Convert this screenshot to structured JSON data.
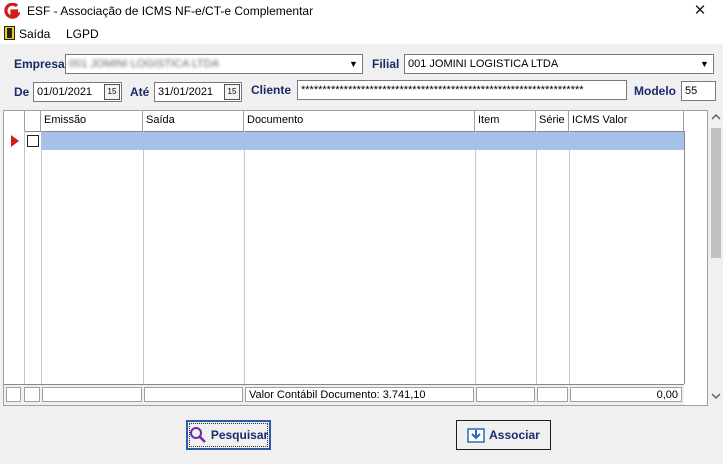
{
  "window": {
    "title": "ESF - Associação de ICMS NF-e/CT-e Complementar",
    "close_glyph": "✕"
  },
  "menu": {
    "items": [
      {
        "label": "Saída"
      },
      {
        "label": "LGPD"
      }
    ]
  },
  "filters": {
    "empresa_label": "Empresa",
    "empresa_value": "001 JOMINI LOGISTICA LTDA",
    "filial_label": "Filial",
    "filial_value": "001 JOMINI LOGISTICA LTDA",
    "de_label": "De",
    "de_value": "01/01/2021",
    "ate_label": "Até",
    "ate_value": "31/01/2021",
    "cliente_label": "Cliente",
    "cliente_value": "******************************************************************",
    "modelo_label": "Modelo",
    "modelo_value": "55",
    "calendar_glyph": "15"
  },
  "grid": {
    "columns": [
      "Emissão",
      "Saída",
      "Documento",
      "Item",
      "Série",
      "ICMS Valor"
    ],
    "footer_documento": "Valor Contábil Documento: 3.741,10",
    "footer_icms": "0,00"
  },
  "buttons": {
    "pesquisar": "Pesquisar",
    "associar": "Associar"
  },
  "colors": {
    "label": "#1a2a6b",
    "selected_row": "#a7c0ea",
    "indicator": "#d21c1c"
  }
}
